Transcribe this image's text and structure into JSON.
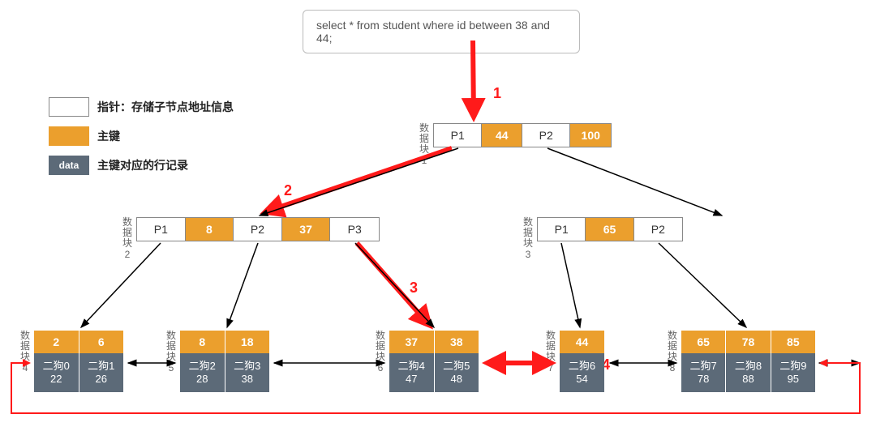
{
  "sql": "select * from student where id between 38 and 44;",
  "legend": {
    "pointer": "指针：存储子节点地址信息",
    "key": "主键",
    "data_label": "data",
    "data": "主键对应的行记录"
  },
  "steps": {
    "s1": "1",
    "s2": "2",
    "s3": "3",
    "s4": "4"
  },
  "block_labels": {
    "b1": "数据块1",
    "b2": "数据块2",
    "b3": "数据块3",
    "b4": "数据块4",
    "b5": "数据块5",
    "b6": "数据块6",
    "b7": "数据块7",
    "b8": "数据块8"
  },
  "root": {
    "p1": "P1",
    "k1": "44",
    "p2": "P2",
    "k2": "100"
  },
  "internal_left": {
    "p1": "P1",
    "k1": "8",
    "p2": "P2",
    "k2": "37",
    "p3": "P3"
  },
  "internal_right": {
    "p1": "P1",
    "k1": "65",
    "p2": "P2"
  },
  "leaves": [
    {
      "id": 4,
      "cols": [
        {
          "k": "2",
          "n": "二狗0",
          "v": "22"
        },
        {
          "k": "6",
          "n": "二狗1",
          "v": "26"
        }
      ]
    },
    {
      "id": 5,
      "cols": [
        {
          "k": "8",
          "n": "二狗2",
          "v": "28"
        },
        {
          "k": "18",
          "n": "二狗3",
          "v": "38"
        }
      ]
    },
    {
      "id": 6,
      "cols": [
        {
          "k": "37",
          "n": "二狗4",
          "v": "47"
        },
        {
          "k": "38",
          "n": "二狗5",
          "v": "48"
        }
      ]
    },
    {
      "id": 7,
      "cols": [
        {
          "k": "44",
          "n": "二狗6",
          "v": "54"
        }
      ]
    },
    {
      "id": 8,
      "cols": [
        {
          "k": "65",
          "n": "二狗7",
          "v": "78"
        },
        {
          "k": "78",
          "n": "二狗8",
          "v": "88"
        },
        {
          "k": "85",
          "n": "二狗9",
          "v": "95"
        }
      ]
    }
  ]
}
